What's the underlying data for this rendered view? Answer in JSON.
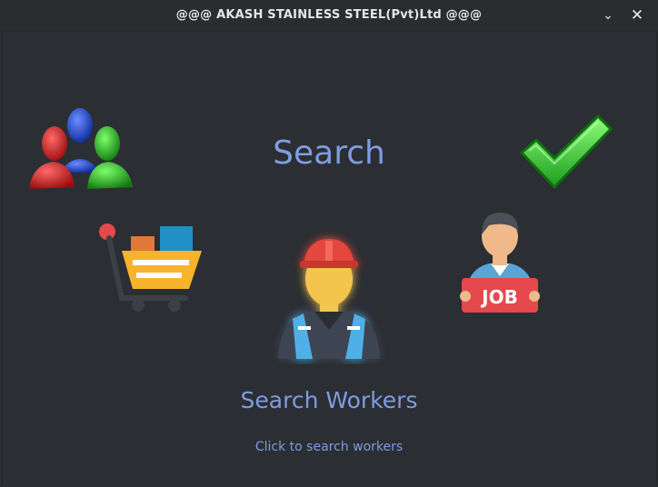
{
  "window": {
    "title": "@@@ AKASH STAINLESS STEEL(Pvt)Ltd @@@",
    "minimize_glyph": "⌄",
    "close_glyph": "✕"
  },
  "main": {
    "heading": "Search",
    "selected_label": "Search Workers",
    "hint": "Click to search workers"
  },
  "icons": {
    "users": "users-group-icon",
    "check": "checkmark-icon",
    "cart": "shopping-cart-icon",
    "worker": "worker-icon",
    "job": "job-seeker-icon",
    "job_sign_text": "JOB"
  },
  "colors": {
    "background": "#2b2e33",
    "accent_text": "#7f9ce2"
  }
}
